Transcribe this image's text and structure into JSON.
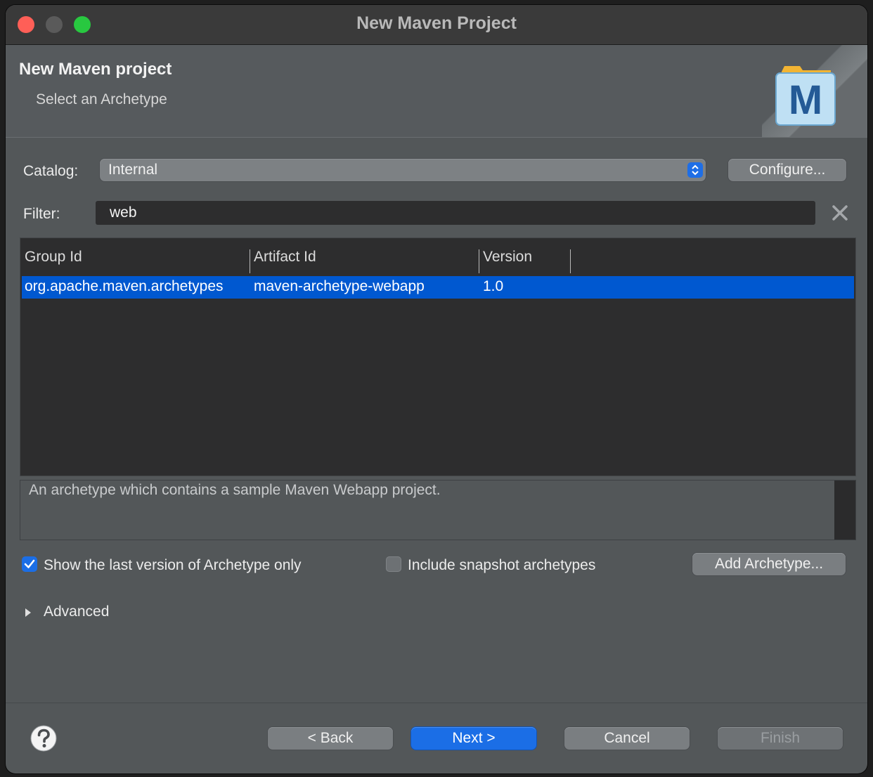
{
  "window": {
    "title": "New Maven Project"
  },
  "header": {
    "title": "New Maven project",
    "subtitle": "Select an Archetype",
    "logo_icon": "maven-m-icon"
  },
  "catalog": {
    "label": "Catalog:",
    "selected": "Internal",
    "configure_label": "Configure..."
  },
  "filter": {
    "label": "Filter:",
    "value": "web",
    "clear_icon": "clear-x-icon"
  },
  "table": {
    "columns": [
      "Group Id",
      "Artifact Id",
      "Version"
    ],
    "rows": [
      {
        "group_id": "org.apache.maven.archetypes",
        "artifact_id": "maven-archetype-webapp",
        "version": "1.0",
        "selected": true
      }
    ]
  },
  "description": "An archetype which contains a sample Maven Webapp project.",
  "options": {
    "last_version_label": "Show the last version of Archetype only",
    "last_version_checked": true,
    "snapshot_label": "Include snapshot archetypes",
    "snapshot_checked": false,
    "add_archetype_label": "Add Archetype..."
  },
  "advanced": {
    "label": "Advanced",
    "expanded": false
  },
  "footer": {
    "help_icon": "help-question-icon",
    "back_label": "< Back",
    "next_label": "Next >",
    "cancel_label": "Cancel",
    "finish_label": "Finish",
    "finish_enabled": false
  },
  "colors": {
    "accent": "#1b6ee6",
    "selection": "#0058d0",
    "close": "#ff5f57",
    "maximize": "#28c840"
  }
}
